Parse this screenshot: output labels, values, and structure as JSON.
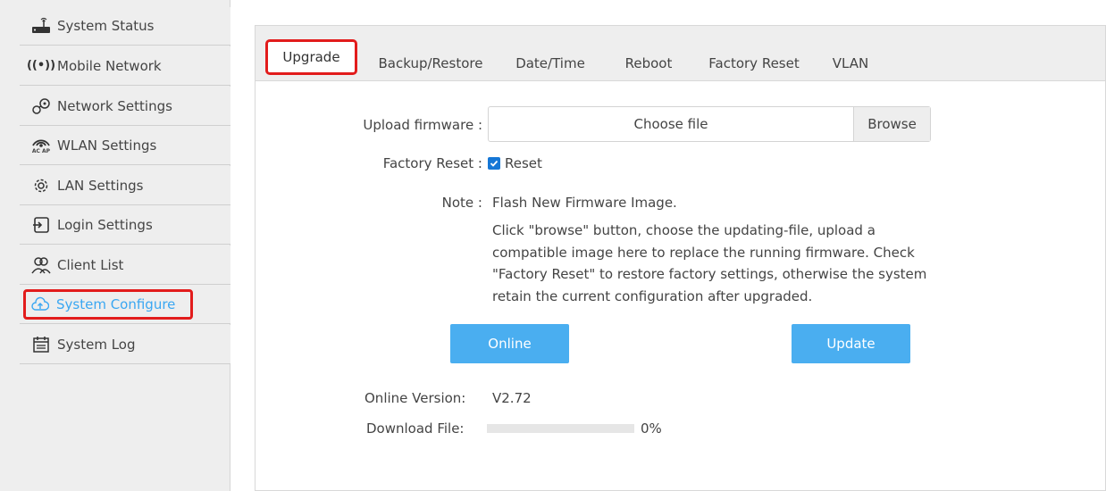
{
  "sidebar": {
    "items": [
      {
        "label": "System Status",
        "icon": "router-icon"
      },
      {
        "label": "Mobile Network",
        "icon": "signal-icon"
      },
      {
        "label": "Network Settings",
        "icon": "network-icon"
      },
      {
        "label": "WLAN Settings",
        "icon": "wifi-icon"
      },
      {
        "label": "LAN Settings",
        "icon": "gear-icon"
      },
      {
        "label": "Login Settings",
        "icon": "login-icon"
      },
      {
        "label": "Client List",
        "icon": "users-icon"
      },
      {
        "label": "System Configure",
        "icon": "cloud-upload-icon",
        "active": true
      },
      {
        "label": "System Log",
        "icon": "calendar-icon"
      }
    ],
    "wlan_badge": "AC AP",
    "mobile_signal_glyph": "((•))"
  },
  "tabs": [
    {
      "label": "Upgrade",
      "active": true
    },
    {
      "label": "Backup/Restore"
    },
    {
      "label": "Date/Time"
    },
    {
      "label": "Reboot"
    },
    {
      "label": "Factory Reset"
    },
    {
      "label": "VLAN"
    }
  ],
  "form": {
    "upload_label": "Upload firmware :",
    "file_placeholder": "Choose file",
    "browse_label": "Browse",
    "factory_reset_label": "Factory Reset :",
    "reset_checkbox_label": "Reset",
    "reset_checked": true,
    "note_label": "Note :",
    "note_title": "Flash New Firmware Image.",
    "note_body": "Click \"browse\" button, choose the updating-file, upload a compatible image here to replace the running firmware. Check \"Factory Reset\" to restore factory settings, otherwise the system retain the current configuration after upgraded."
  },
  "buttons": {
    "online": "Online",
    "update": "Update"
  },
  "status": {
    "online_version_label": "Online Version:",
    "online_version_value": "V2.72",
    "download_label": "Download File:",
    "download_percent_text": "0%",
    "download_progress": 0
  },
  "colors": {
    "accent": "#4aaef0",
    "active_text": "#3aa7f2",
    "highlight": "#e21c1c",
    "sidebar_bg": "#eeeeee"
  }
}
